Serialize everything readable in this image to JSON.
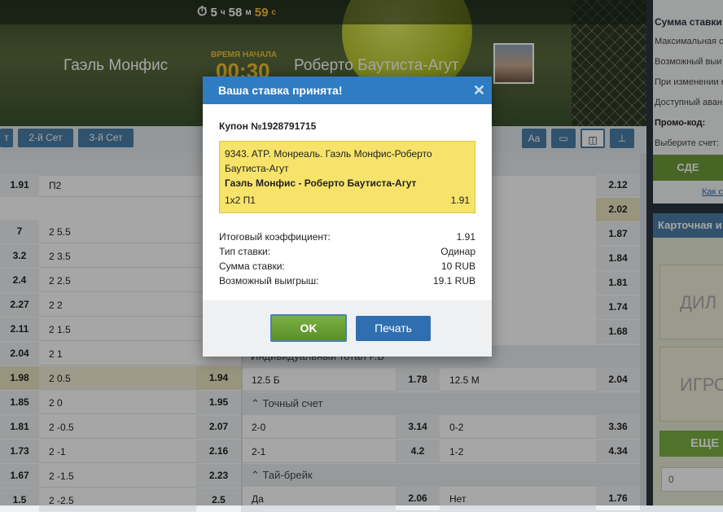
{
  "header": {
    "timer": {
      "hours": "5",
      "h_unit": "ч",
      "minutes": "58",
      "m_unit": "м",
      "seconds": "59",
      "s_unit": "с"
    },
    "team1": "Гаэль Монфис",
    "team2": "Роберто Баутиста-Агут",
    "start_label": "ВРЕМЯ НАЧАЛА",
    "start_time": "00:30"
  },
  "sets": {
    "set1": "т",
    "set2": "2-й Сет",
    "set3": "3-й Сет"
  },
  "tools": {
    "font": "Aa"
  },
  "left_rows": [
    {
      "a": "1.91",
      "b": "П2",
      "c": "",
      "hl": false
    },
    {
      "a": "7",
      "b": "2 5.5",
      "c": "",
      "hl": false
    },
    {
      "a": "3.2",
      "b": "2 3.5",
      "c": "",
      "hl": false
    },
    {
      "a": "2.4",
      "b": "2 2.5",
      "c": "",
      "hl": false
    },
    {
      "a": "2.27",
      "b": "2 2",
      "c": "",
      "hl": false
    },
    {
      "a": "2.11",
      "b": "2 1.5",
      "c": "",
      "hl": false
    },
    {
      "a": "2.04",
      "b": "2 1",
      "c": "",
      "hl": false
    },
    {
      "a": "1.98",
      "b": "2 0.5",
      "c": "1.94",
      "hl": true
    },
    {
      "a": "1.85",
      "b": "2 0",
      "c": "1.95",
      "hl": false
    },
    {
      "a": "1.81",
      "b": "2 -0.5",
      "c": "2.07",
      "hl": false
    },
    {
      "a": "1.73",
      "b": "2 -1",
      "c": "2.16",
      "hl": false
    },
    {
      "a": "1.67",
      "b": "2 -1.5",
      "c": "2.23",
      "hl": false
    },
    {
      "a": "1.5",
      "b": "2 -2.5",
      "c": "2.5",
      "hl": false
    }
  ],
  "right_top_values": [
    "2.12",
    "2.02",
    "1.87",
    "1.84",
    "1.81",
    "1.74",
    "1.68"
  ],
  "individual_total": {
    "header": "Индивидуальный тотал Р.Б",
    "left": "12.5 Б",
    "left_odd": "1.78",
    "right": "12.5 М",
    "right_odd": "2.04"
  },
  "exact_score": {
    "header": "Точный счет",
    "rows": [
      {
        "l": "2-0",
        "lo": "3.14",
        "r": "0-2",
        "ro": "3.36"
      },
      {
        "l": "2-1",
        "lo": "4.2",
        "r": "1-2",
        "ro": "4.34"
      }
    ]
  },
  "tiebreak": {
    "header": "Тай-брейк",
    "l": "Да",
    "lo": "2.06",
    "r": "Нет",
    "ro": "1.76"
  },
  "sidebar": {
    "stake_title": "Сумма ставки",
    "max": "Максимальная с",
    "possible": "Возможный выи",
    "change": "При изменении к",
    "available": "Доступный аван",
    "promo": "Промо-код:",
    "account": "Выберите счет:",
    "button": "СДЕ",
    "link": "Как с",
    "card_title": "Карточная и",
    "tile1": "ДИЛ",
    "tile2": "ИГРО",
    "more": "ЕЩЕ",
    "input": "0"
  },
  "modal": {
    "title": "Ваша ставка принята!",
    "coupon": "Купон №1928791715",
    "event_line1": "9343. ATP. Монреаль. Гаэль Монфис-Роберто",
    "event_line2": "Баутиста-Агут",
    "match": "Гаэль Монфис - Роберто Баутиста-Агут",
    "outcome": "1x2 П1",
    "odd": "1.91",
    "total_label": "Итоговый коэффициент:",
    "total_value": "1.91",
    "type_label": "Тип ставки:",
    "type_value": "Одинар",
    "stake_label": "Сумма ставки:",
    "stake_value": "10 RUB",
    "win_label": "Возможный выигрыш:",
    "win_value": "19.1 RUB",
    "ok": "OK",
    "print": "Печать"
  },
  "colors": {
    "accent": "#2f7cc2",
    "highlight": "#f7e36a",
    "ok": "#6d9c3a"
  }
}
